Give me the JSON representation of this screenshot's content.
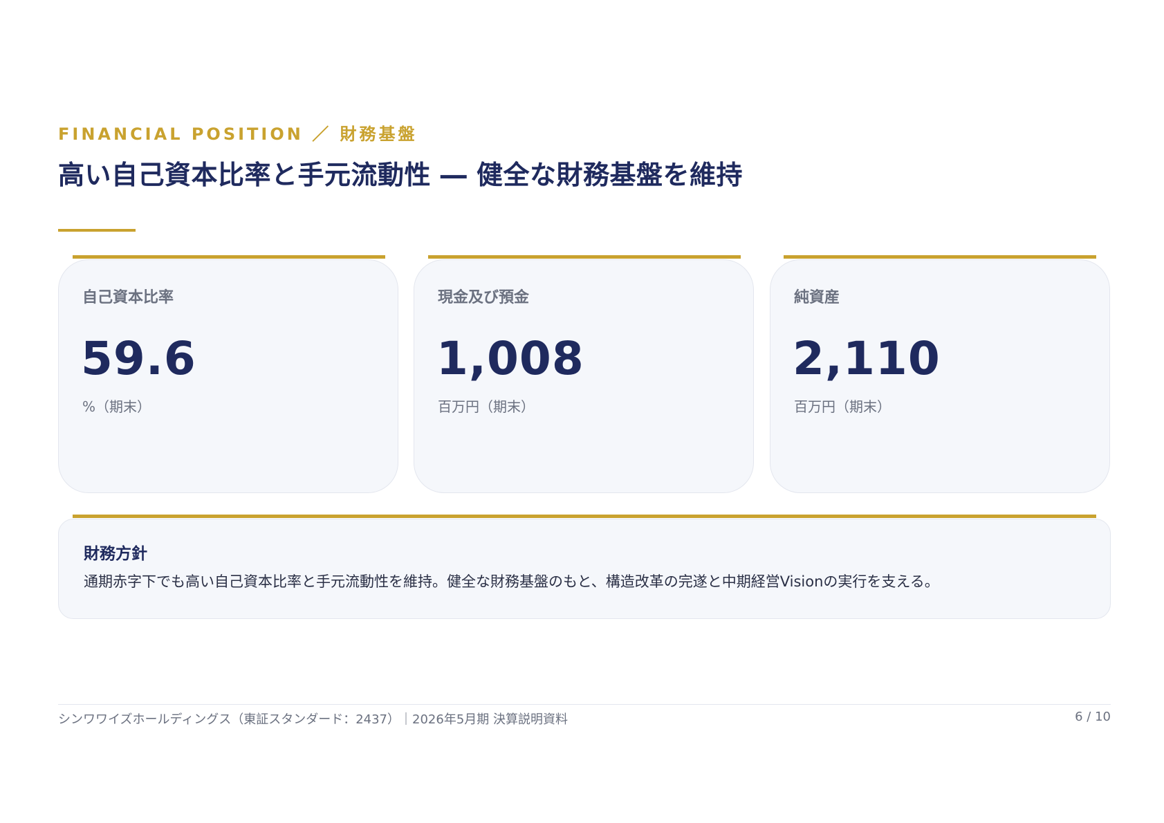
{
  "header": {
    "eyebrow": "FINANCIAL POSITION ／ 財務基盤",
    "title": "高い自己資本比率と手元流動性 ― 健全な財務基盤を維持"
  },
  "cards": [
    {
      "label": "自己資本比率",
      "value": "59.6",
      "unit": "%（期末）"
    },
    {
      "label": "現金及び預金",
      "value": "1,008",
      "unit": "百万円（期末）"
    },
    {
      "label": "純資産",
      "value": "2,110",
      "unit": "百万円（期末）"
    }
  ],
  "policy": {
    "heading": "財務方針",
    "body": "通期赤字下でも高い自己資本比率と手元流動性を維持。健全な財務基盤のもと、構造改革の完遂と中期経営Visionの実行を支える。"
  },
  "footer": {
    "left": "シンワワイズホールディングス（東証スタンダード：2437）｜2026年5月期 決算説明資料",
    "page": "6 / 10"
  },
  "colors": {
    "accent_gold": "#c9a22f",
    "navy": "#1f2a5e",
    "card_bg": "#f5f7fb"
  }
}
